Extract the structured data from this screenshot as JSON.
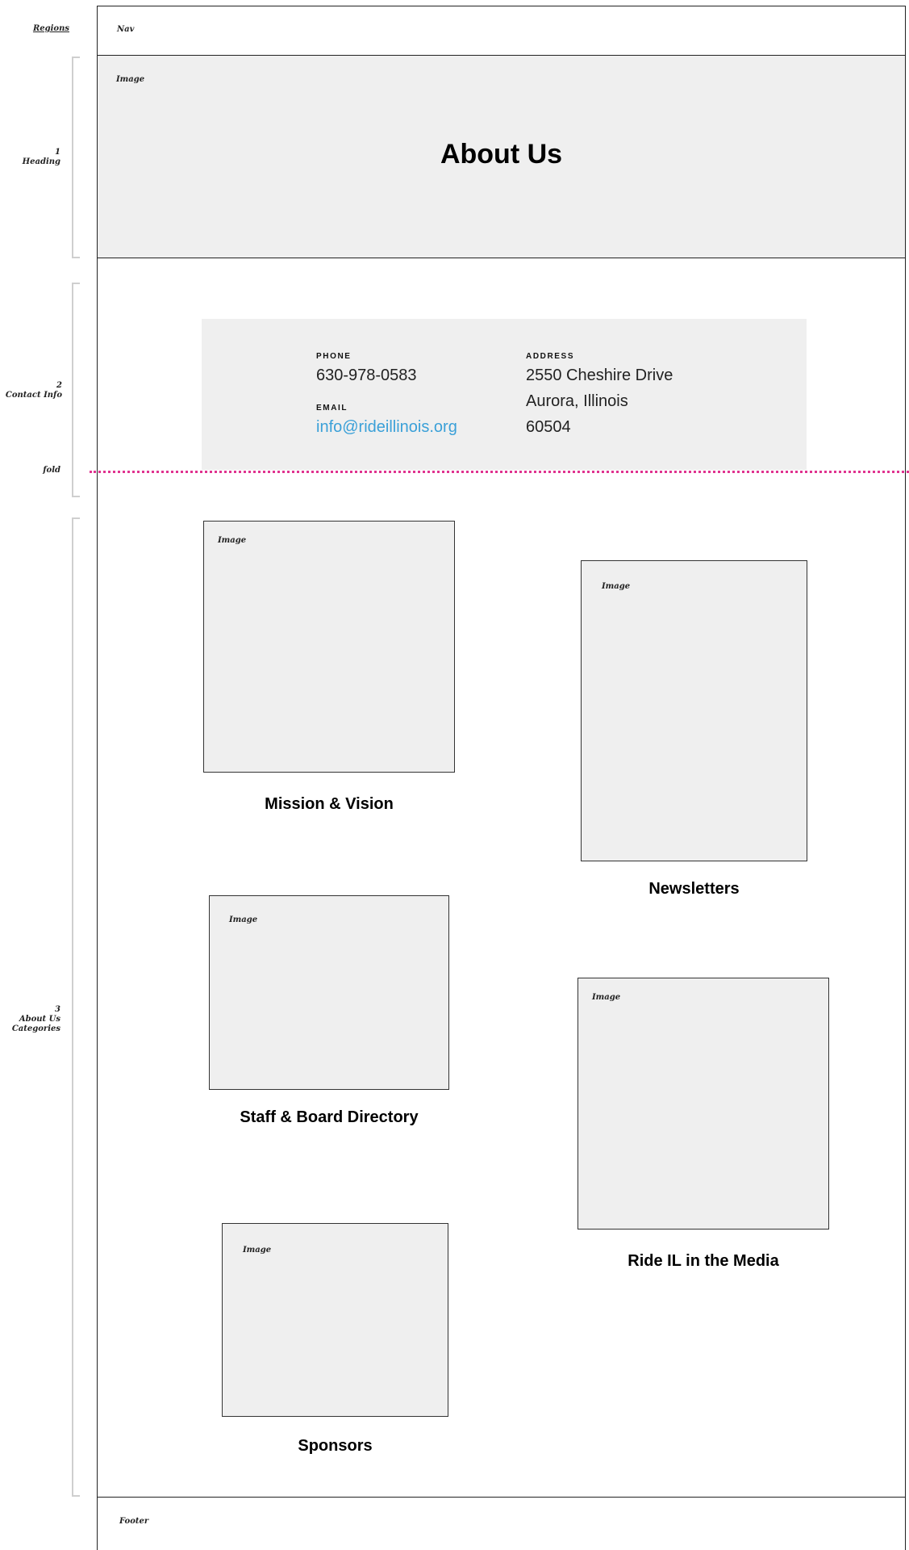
{
  "regions": {
    "header": "Regions",
    "heading": {
      "number": "1",
      "name": "Heading"
    },
    "contact": {
      "number": "2",
      "name": "Contact Info"
    },
    "fold": "fold",
    "categories": {
      "number": "3",
      "name_line1": "About Us",
      "name_line2": "Categories"
    }
  },
  "nav": {
    "label": "Nav"
  },
  "hero": {
    "image_label": "Image",
    "title": "About Us"
  },
  "contact": {
    "phone_caption": "PHONE",
    "phone": "630-978-0583",
    "email_caption": "EMAIL",
    "email": "info@rideillinois.org",
    "address_caption": "ADDRESS",
    "address_line1": "2550 Cheshire Drive",
    "address_line2": "Aurora, Illinois",
    "address_line3": "60504",
    "link_color": "#3aa0d8"
  },
  "categories": [
    {
      "image_label": "Image",
      "title": "Mission & Vision"
    },
    {
      "image_label": "Image",
      "title": "Newsletters"
    },
    {
      "image_label": "Image",
      "title": "Staff & Board Directory"
    },
    {
      "image_label": "Image",
      "title": "Ride IL in the Media"
    },
    {
      "image_label": "Image",
      "title": "Sponsors"
    }
  ],
  "footer": {
    "label": "Footer"
  },
  "colors": {
    "fold_line": "#e0338f",
    "placeholder_fill": "#efefef"
  }
}
